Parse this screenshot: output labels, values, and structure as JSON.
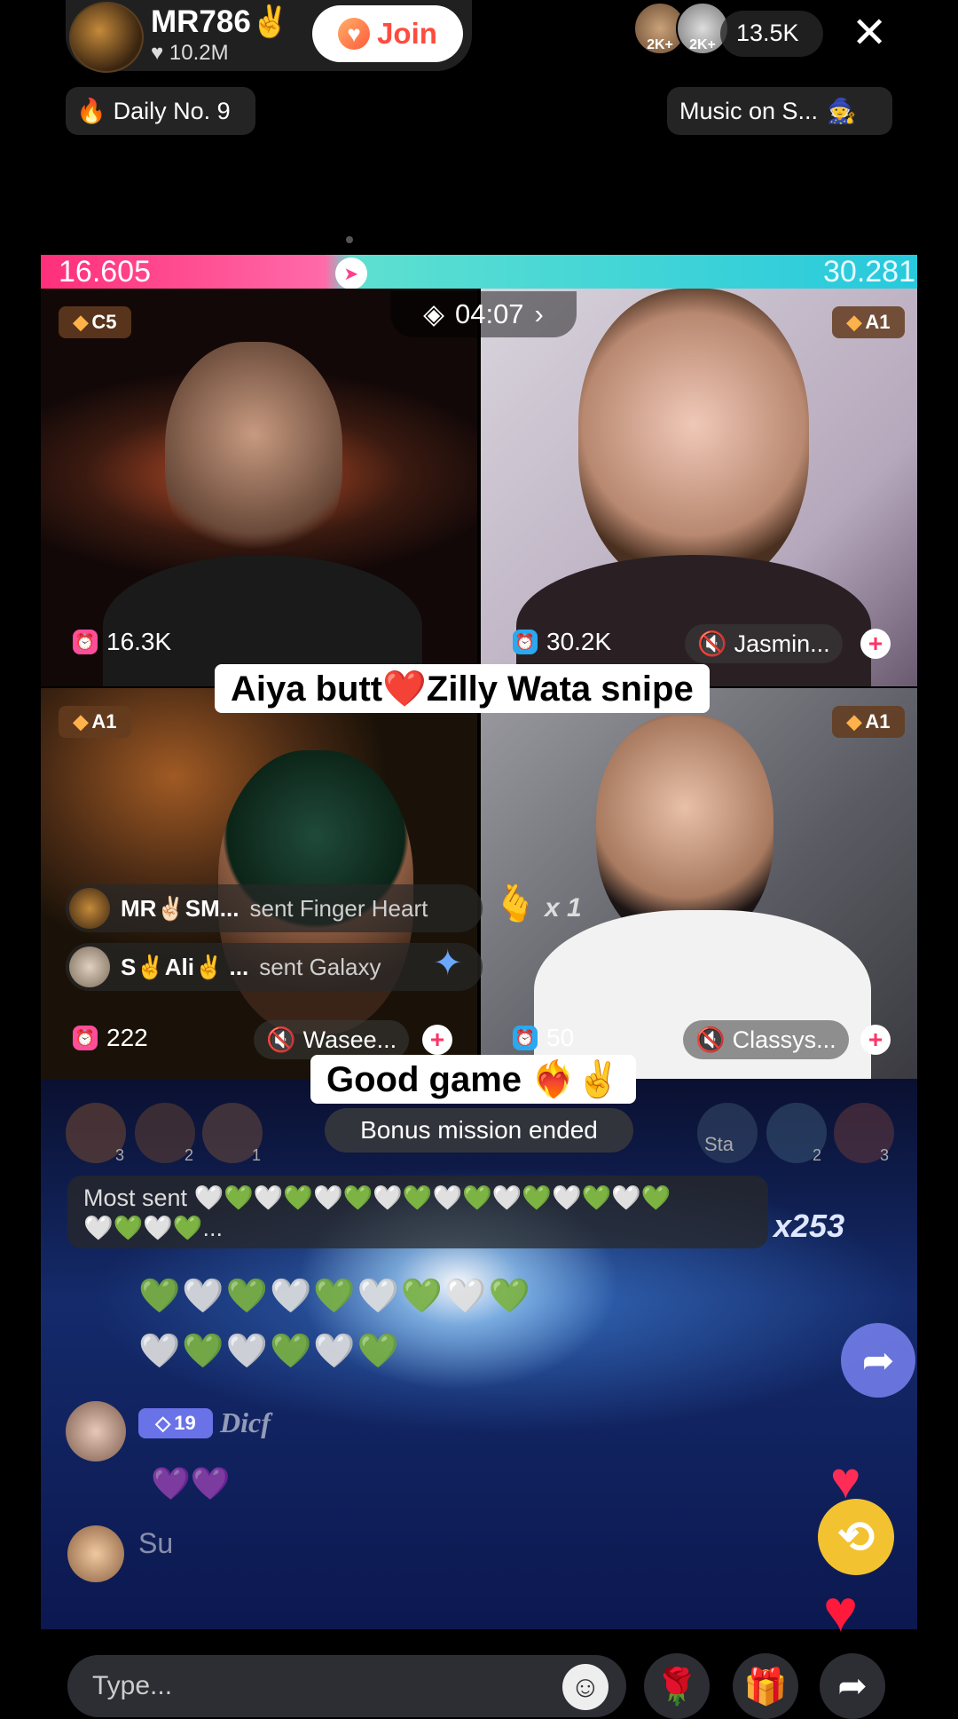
{
  "host": {
    "name": "MR786✌️",
    "likes": "10.2M",
    "join_label": "Join"
  },
  "viewers": {
    "badge1": "2K+",
    "badge2": "2K+",
    "count": "13.5K"
  },
  "top": {
    "close": "✕",
    "daily": "Daily No. 9",
    "music": "Music on S..."
  },
  "battle": {
    "score_left": "16.605",
    "score_right": "30.281",
    "score_left_fraction": 0.354,
    "timer": "04:07"
  },
  "tiles": [
    {
      "badge": "C5",
      "likes": "16.3K"
    },
    {
      "badge": "A1",
      "likes": "30.2K",
      "name": "Jasmin..."
    },
    {
      "badge": "A1",
      "likes": "222",
      "name": "Wasee..."
    },
    {
      "badge": "A1",
      "likes": "50",
      "name": "Classys..."
    }
  ],
  "captions": {
    "upper": "Aiya butt❤️Zilly Wata snipe",
    "lower": "Good game ❤️‍🔥✌️"
  },
  "gifts": [
    {
      "user": "MR✌🏻SM...",
      "text": "sent Finger Heart",
      "count": "x 1"
    },
    {
      "user": "S✌️Ali✌️ ...",
      "text": "sent Galaxy"
    }
  ],
  "leaderboard": {
    "left_ranks": [
      "3",
      "2",
      "1"
    ],
    "right_labels": [
      "Sta",
      "2",
      "3"
    ]
  },
  "bonus_text": "Bonus mission ended",
  "most_sent": {
    "label": "Most sent",
    "multiplier": "x253",
    "hearts_line1": "🤍💚🤍💚🤍💚🤍💚🤍💚🤍💚🤍💚🤍💚",
    "hearts_line2": "🤍💚🤍💚..."
  },
  "chat": [
    {
      "level": "19",
      "text": "Dicf"
    },
    {
      "text": "Su"
    }
  ],
  "input": {
    "placeholder": "Type..."
  },
  "colors": {
    "pink": "#ff2f7a",
    "cyan": "#26c9dd",
    "join_text": "#ff4b3e",
    "gold": "#ffb14a"
  }
}
